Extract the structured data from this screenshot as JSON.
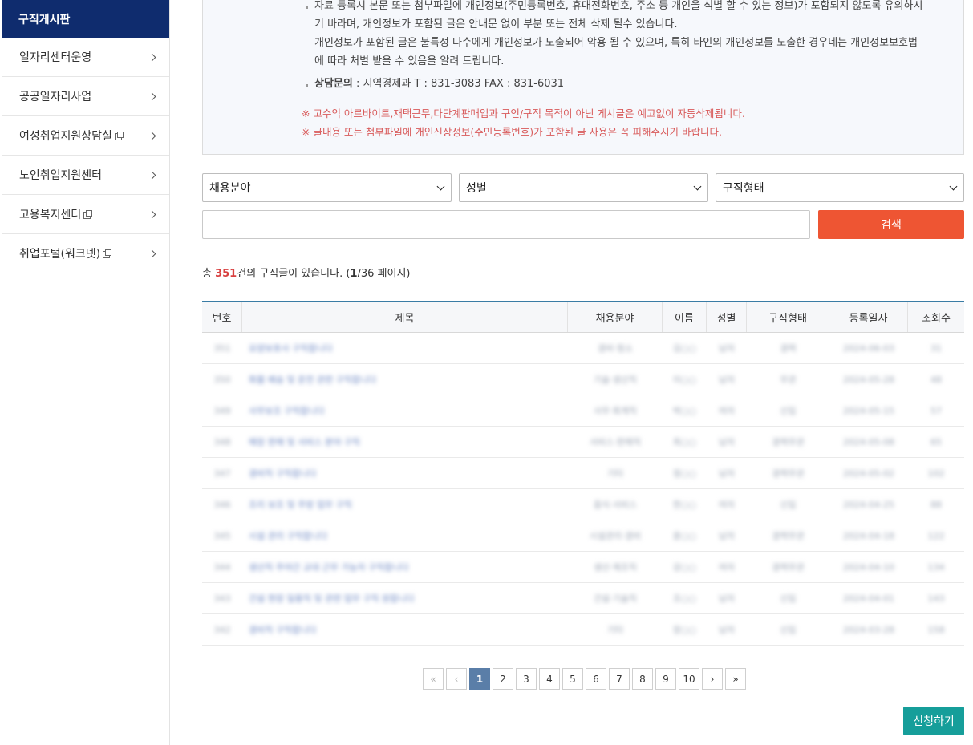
{
  "sidebar": {
    "header": "구직게시판",
    "items": [
      {
        "label": "일자리센터운영",
        "external": false
      },
      {
        "label": "공공일자리사업",
        "external": false
      },
      {
        "label": "여성취업지원상담실",
        "external": true
      },
      {
        "label": "노인취업지원센터",
        "external": false
      },
      {
        "label": "고용복지센터",
        "external": true
      },
      {
        "label": "취업포털(워크넷)",
        "external": true
      }
    ]
  },
  "notice": {
    "line1": "자료 등록시 본문 또는 첨부파일에 개인정보(주민등록번호, 휴대전화번호, 주소 등 개인을 식별 할 수 있는 정보)가 포함되지 않도록 유의하시",
    "line2": "기 바라며, 개인정보가 포함된 글은 안내문 없이 부분 또는 전체 삭제 될수 있습니다.",
    "line3": "개인정보가 포함된 글은 불특정 다수에게 개인정보가 노출되어 악용 될 수 있으며, 특히 타인의 개인정보를 노출한 경우네는 개인정보보호법",
    "line4": "에 따라 처벌 받을 수 있음을 알려 드립니다.",
    "contact_label": "상담문의",
    "contact_text": " : 지역경제과 T : 831-3083 FAX : 831-6031",
    "warn1": "※ 고수익 아르바이트,재택근무,다단계판매업과 구인/구직 목적이 아닌 게시글은 예고없이 자동삭제됩니다.",
    "warn2": "※ 글내용 또는 첨부파일에 개인신상정보(주민등록번호)가 포함된 글 사용은 꼭 피해주시기 바랍니다."
  },
  "filters": {
    "field": "채용분야",
    "gender": "성별",
    "type": "구직형태",
    "search_label": "검색",
    "search_value": ""
  },
  "count": {
    "prefix": "총 ",
    "total": "351",
    "mid": "건의 구직글이 있습니다. (",
    "page": "1",
    "pages": "/36 페이지)"
  },
  "table": {
    "headers": [
      "번호",
      "제목",
      "채용분야",
      "이름",
      "성별",
      "구직형태",
      "등록일자",
      "조회수"
    ],
    "rows": [
      [
        "351",
        "요양보호사 구직합니다",
        "경비·청소",
        "김○○",
        "남자",
        "경력",
        "2024-06-03",
        "31"
      ],
      [
        "350",
        "화물 배송 및 운전 관련 구직합니다",
        "기술·생산직",
        "이○○",
        "남자",
        "무관",
        "2024-05-28",
        "48"
      ],
      [
        "349",
        "사무보조 구직합니다",
        "사무·회계직",
        "박○○",
        "여자",
        "신입",
        "2024-05-15",
        "57"
      ],
      [
        "348",
        "매장 판매 및 서비스 분야 구직",
        "서비스·판매직",
        "최○○",
        "남자",
        "경력무관",
        "2024-05-08",
        "65"
      ],
      [
        "347",
        "경비직 구직합니다",
        "기타",
        "정○○",
        "남자",
        "경력무관",
        "2024-05-02",
        "102"
      ],
      [
        "346",
        "조리 보조 및 주방 업무 구직",
        "음식·서비스",
        "한○○",
        "여자",
        "신입",
        "2024-04-25",
        "88"
      ],
      [
        "345",
        "시설 관리 구직합니다",
        "시설관리·경비",
        "윤○○",
        "남자",
        "경력무관",
        "2024-04-18",
        "122"
      ],
      [
        "344",
        "생산직 주야간 교대 근무 가능자 구직합니다",
        "생산·제조직",
        "강○○",
        "여자",
        "경력무관",
        "2024-04-10",
        "134"
      ],
      [
        "343",
        "건설 현장 일용직 및 관련 업무 구직 원합니다",
        "건설·기술직",
        "조○○",
        "남자",
        "신입",
        "2024-04-01",
        "143"
      ],
      [
        "342",
        "경비직 구직합니다",
        "기타",
        "장○○",
        "남자",
        "신입",
        "2024-03-28",
        "158"
      ]
    ]
  },
  "pagination": {
    "first": "«",
    "prev": "‹",
    "pages": [
      "1",
      "2",
      "3",
      "4",
      "5",
      "6",
      "7",
      "8",
      "9",
      "10"
    ],
    "next": "›",
    "last": "»",
    "current": "1"
  },
  "apply_label": "신청하기"
}
